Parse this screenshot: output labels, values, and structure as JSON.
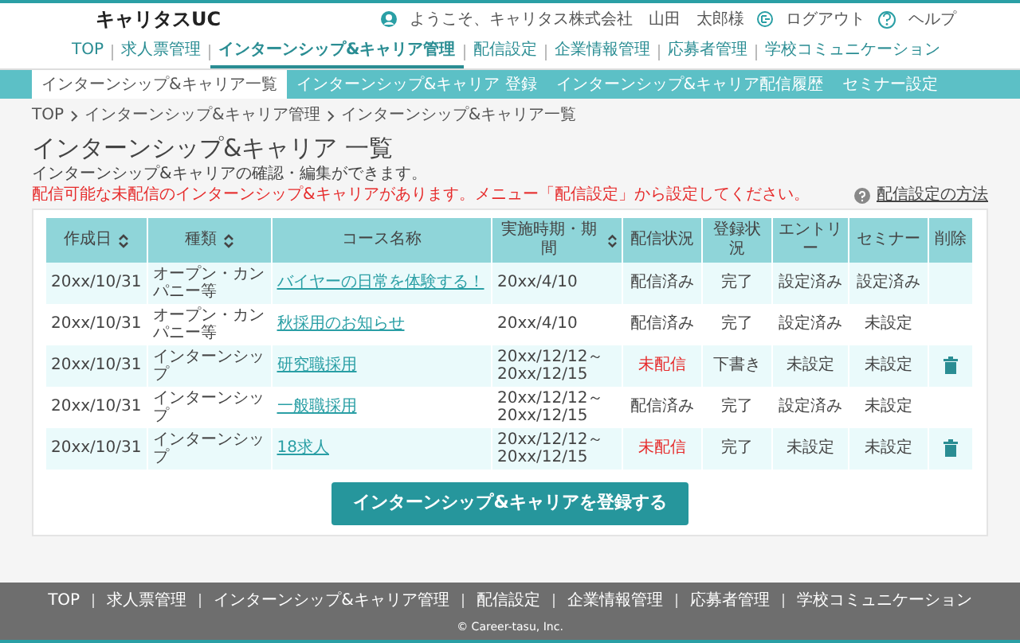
{
  "header": {
    "logo": "キャリタスUC",
    "welcome": "ようこそ、キャリタス株式会社　山田　太郎様",
    "logout": "ログアウト",
    "help": "ヘルプ"
  },
  "nav": [
    {
      "label": "TOP",
      "selected": false
    },
    {
      "label": "求人票管理",
      "selected": false
    },
    {
      "label": "インターンシップ&キャリア管理",
      "selected": true
    },
    {
      "label": "配信設定",
      "selected": false
    },
    {
      "label": "企業情報管理",
      "selected": false
    },
    {
      "label": "応募者管理",
      "selected": false
    },
    {
      "label": "学校コミュニケーション",
      "selected": false
    }
  ],
  "subnav": [
    {
      "label": "インターンシップ&キャリア一覧",
      "selected": true
    },
    {
      "label": "インターンシップ&キャリア 登録",
      "selected": false
    },
    {
      "label": "インターンシップ&キャリア配信履歴",
      "selected": false
    },
    {
      "label": "セミナー設定",
      "selected": false
    }
  ],
  "breadcrumb": [
    "TOP",
    "インターンシップ&キャリア管理",
    "インターンシップ&キャリア一覧"
  ],
  "title": "インターンシップ&キャリア 一覧",
  "description": "インターンシップ&キャリアの確認・編集ができます。",
  "alert": "配信可能な未配信のインターンシップ&キャリアがあります。メニュー「配信設定」から設定してください。",
  "help_link": "配信設定の方法",
  "table": {
    "columns": [
      {
        "label": "作成日",
        "sortable": true
      },
      {
        "label": "種類",
        "sortable": true
      },
      {
        "label": "コース名称",
        "sortable": false
      },
      {
        "label": "実施時期・期間",
        "sortable": true
      },
      {
        "label": "配信状況",
        "sortable": false
      },
      {
        "label": "登録状況",
        "sortable": false
      },
      {
        "label": "エントリー",
        "sortable": false
      },
      {
        "label": "セミナー",
        "sortable": false
      },
      {
        "label": "削除",
        "sortable": false
      }
    ],
    "rows": [
      {
        "created": "20xx/10/31",
        "type": "オープン・カンパニー等",
        "course": "バイヤーの日常を体験する！",
        "period": [
          "20xx/4/10"
        ],
        "delivery": {
          "text": "配信済み",
          "alert": false
        },
        "registration": "完了",
        "entry": "設定済み",
        "seminar": "設定済み",
        "deletable": false
      },
      {
        "created": "20xx/10/31",
        "type": "オープン・カンパニー等",
        "course": "秋採用のお知らせ",
        "period": [
          "20xx/4/10"
        ],
        "delivery": {
          "text": "配信済み",
          "alert": false
        },
        "registration": "完了",
        "entry": "設定済み",
        "seminar": "未設定",
        "deletable": false
      },
      {
        "created": "20xx/10/31",
        "type": "インターンシップ",
        "course": "研究職採用",
        "period": [
          "20xx/12/12～",
          "20xx/12/15"
        ],
        "delivery": {
          "text": "未配信",
          "alert": true
        },
        "registration": "下書き",
        "entry": "未設定",
        "seminar": "未設定",
        "deletable": true
      },
      {
        "created": "20xx/10/31",
        "type": "インターンシップ",
        "course": "一般職採用",
        "period": [
          "20xx/12/12～",
          "20xx/12/15"
        ],
        "delivery": {
          "text": "配信済み",
          "alert": false
        },
        "registration": "完了",
        "entry": "設定済み",
        "seminar": "未設定",
        "deletable": false
      },
      {
        "created": "20xx/10/31",
        "type": "インターンシップ",
        "course": "18求人",
        "period": [
          "20xx/12/12～",
          "20xx/12/15"
        ],
        "delivery": {
          "text": "未配信",
          "alert": true
        },
        "registration": "完了",
        "entry": "未設定",
        "seminar": "未設定",
        "deletable": true
      }
    ]
  },
  "register_button": "インターンシップ&キャリアを登録する",
  "footer": {
    "links": [
      "TOP",
      "求人票管理",
      "インターンシップ&キャリア管理",
      "配信設定",
      "企業情報管理",
      "応募者管理",
      "学校コミュニケーション"
    ],
    "copyright": "© Career-tasu, Inc."
  }
}
